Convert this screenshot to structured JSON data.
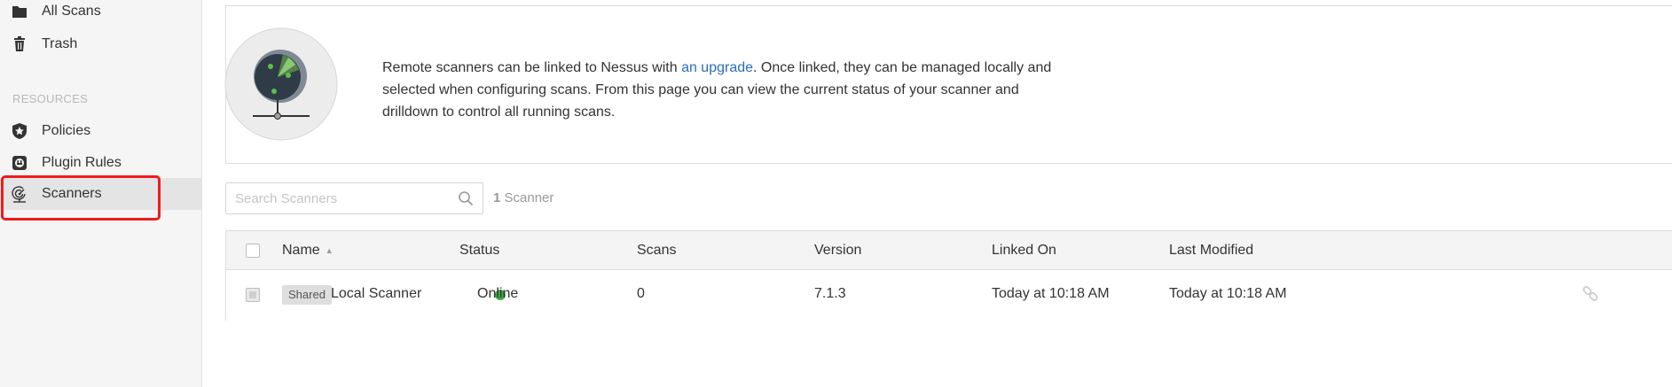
{
  "sidebar": {
    "items_top": [
      {
        "label": "All Scans",
        "icon": "folder-icon"
      },
      {
        "label": "Trash",
        "icon": "trash-icon"
      }
    ],
    "section_title": "RESOURCES",
    "items_resources": [
      {
        "label": "Policies",
        "icon": "policy-shield-icon"
      },
      {
        "label": "Plugin Rules",
        "icon": "plugin-rules-icon"
      },
      {
        "label": "Scanners",
        "icon": "scanner-icon",
        "active": true
      }
    ]
  },
  "info": {
    "text_before_link": "Remote scanners can be linked to Nessus with ",
    "link_text": "an upgrade",
    "text_after_link": ". Once linked, they can be managed locally and selected when configuring scans. From this page you can view the current status of your scanner and drilldown to control all running scans."
  },
  "search": {
    "placeholder": "Search Scanners"
  },
  "count": {
    "number": "1",
    "label": " Scanner"
  },
  "table": {
    "headers": [
      "Name",
      "Status",
      "Scans",
      "Version",
      "Linked On",
      "Last Modified"
    ],
    "rows": [
      {
        "badge": "Shared",
        "name": "Local Scanner",
        "status": "Online",
        "scans": "0",
        "version": "7.1.3",
        "linked_on": "Today at 10:18 AM",
        "last_modified": "Today at 10:18 AM"
      }
    ]
  },
  "colors": {
    "accent_link": "#2a6ebb",
    "status_online": "#3fae49",
    "highlight": "#ee1c1c"
  }
}
